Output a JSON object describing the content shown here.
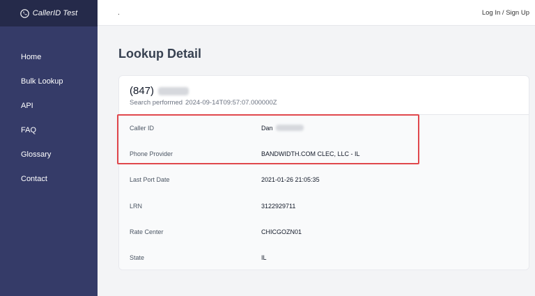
{
  "brand": {
    "name": "CallerID Test",
    "icon": "phone-circle-icon"
  },
  "sidebar": {
    "items": [
      {
        "label": "Home"
      },
      {
        "label": "Bulk Lookup"
      },
      {
        "label": "API"
      },
      {
        "label": "FAQ"
      },
      {
        "label": "Glossary"
      },
      {
        "label": "Contact"
      }
    ]
  },
  "topbar": {
    "dot": ".",
    "auth_label": "Log In / Sign Up"
  },
  "page": {
    "title": "Lookup Detail"
  },
  "lookup": {
    "phone_area": "(847)",
    "search_prefix": "Search performed",
    "timestamp": "2024-09-14T09:57:07.000000Z",
    "rows": [
      {
        "label": "Caller ID",
        "value": "Dan"
      },
      {
        "label": "Phone Provider",
        "value": "BANDWIDTH.COM CLEC, LLC - IL"
      },
      {
        "label": "Last Port Date",
        "value": "2021-01-26 21:05:35"
      },
      {
        "label": "LRN",
        "value": "3122929711"
      },
      {
        "label": "Rate Center",
        "value": "CHICGOZN01"
      },
      {
        "label": "State",
        "value": "IL"
      }
    ]
  },
  "colors": {
    "sidebar_bg": "#353b68",
    "brand_bg": "#252a4a",
    "highlight": "#e0474c",
    "page_bg": "#f3f4f6"
  }
}
